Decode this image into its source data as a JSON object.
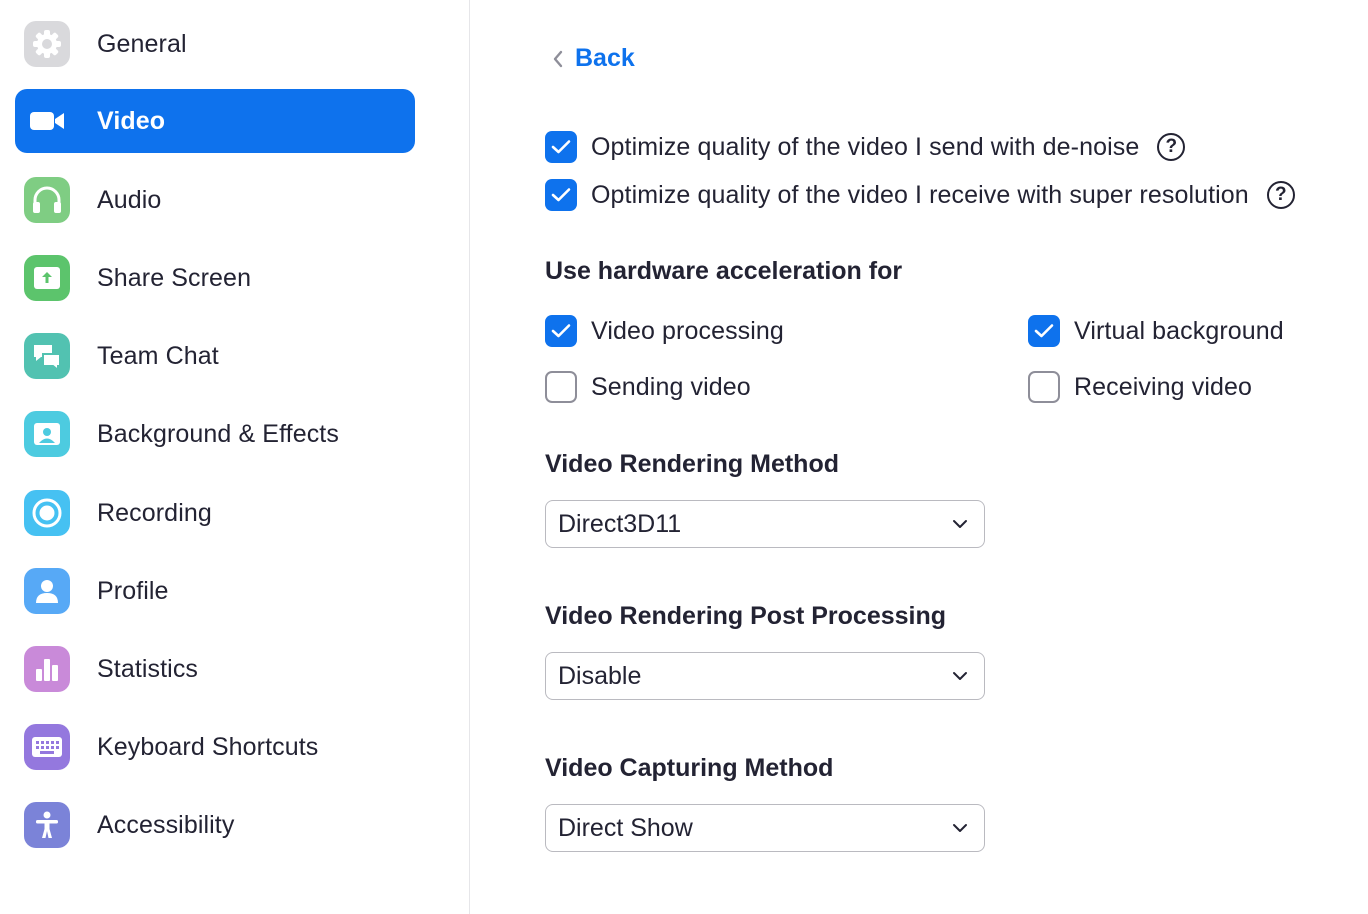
{
  "sidebar": {
    "items": [
      {
        "label": "General",
        "icon": "gear-icon",
        "color": "#d9d9dc",
        "active": false
      },
      {
        "label": "Video",
        "icon": "video-camera-icon",
        "color": "#0e72ed",
        "active": true
      },
      {
        "label": "Audio",
        "icon": "headphones-icon",
        "color": "#7fcd83",
        "active": false
      },
      {
        "label": "Share Screen",
        "icon": "share-screen-icon",
        "color": "#5cc46c",
        "active": false
      },
      {
        "label": "Team Chat",
        "icon": "chat-bubbles-icon",
        "color": "#52c2b1",
        "active": false
      },
      {
        "label": "Background & Effects",
        "icon": "portrait-icon",
        "color": "#4dcbe0",
        "active": false
      },
      {
        "label": "Recording",
        "icon": "record-icon",
        "color": "#46c1f2",
        "active": false
      },
      {
        "label": "Profile",
        "icon": "person-icon",
        "color": "#57a9f6",
        "active": false
      },
      {
        "label": "Statistics",
        "icon": "bar-chart-icon",
        "color": "#c98ad9",
        "active": false
      },
      {
        "label": "Keyboard Shortcuts",
        "icon": "keyboard-icon",
        "color": "#9478de",
        "active": false
      },
      {
        "label": "Accessibility",
        "icon": "accessibility-icon",
        "color": "#7b83d8",
        "active": false
      }
    ]
  },
  "main": {
    "back_label": "Back",
    "optimize": [
      {
        "label": "Optimize quality of the video I send with de-noise",
        "checked": true
      },
      {
        "label": "Optimize quality of the video I receive with super resolution",
        "checked": true
      }
    ],
    "hw_title": "Use hardware acceleration for",
    "hw_options": [
      {
        "label": "Video processing",
        "checked": true
      },
      {
        "label": "Virtual background",
        "checked": true
      },
      {
        "label": "Sending video",
        "checked": false
      },
      {
        "label": "Receiving video",
        "checked": false
      }
    ],
    "rendering_method": {
      "title": "Video Rendering Method",
      "value": "Direct3D11"
    },
    "post_processing": {
      "title": "Video Rendering Post Processing",
      "value": "Disable"
    },
    "capturing_method": {
      "title": "Video Capturing Method",
      "value": "Direct Show"
    },
    "help_glyph": "?",
    "colors": {
      "accent": "#0e72ed",
      "text": "#232333"
    }
  }
}
